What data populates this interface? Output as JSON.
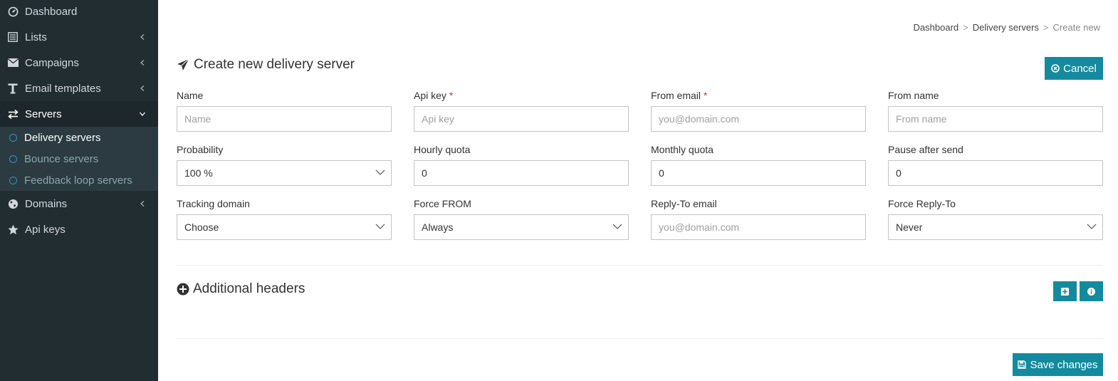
{
  "sidebar": {
    "items": [
      {
        "label": "Dashboard",
        "icon": "dashboard-icon"
      },
      {
        "label": "Lists",
        "icon": "list-icon"
      },
      {
        "label": "Campaigns",
        "icon": "envelope-icon"
      },
      {
        "label": "Email templates",
        "icon": "text-icon"
      },
      {
        "label": "Servers",
        "icon": "exchange-icon"
      },
      {
        "label": "Domains",
        "icon": "globe-icon"
      },
      {
        "label": "Api keys",
        "icon": "star-icon"
      }
    ],
    "submenu": [
      {
        "label": "Delivery servers"
      },
      {
        "label": "Bounce servers"
      },
      {
        "label": "Feedback loop servers"
      }
    ]
  },
  "breadcrumb": {
    "items": [
      "Dashboard",
      "Delivery servers"
    ],
    "separator": ">",
    "current": "Create new"
  },
  "page": {
    "title": "Create new delivery server",
    "cancel_label": "Cancel",
    "save_label": "Save changes"
  },
  "form": {
    "required_mark": "*",
    "name": {
      "label": "Name",
      "placeholder": "Name"
    },
    "api_key": {
      "label": "Api key",
      "placeholder": "Api key"
    },
    "from_email": {
      "label": "From email",
      "placeholder": "you@domain.com"
    },
    "from_name": {
      "label": "From name",
      "placeholder": "From name"
    },
    "probability": {
      "label": "Probability",
      "value": "100 %"
    },
    "hourly_quota": {
      "label": "Hourly quota",
      "value": "0"
    },
    "monthly_quota": {
      "label": "Monthly quota",
      "value": "0"
    },
    "pause_after_send": {
      "label": "Pause after send",
      "value": "0"
    },
    "tracking_domain": {
      "label": "Tracking domain",
      "value": "Choose"
    },
    "force_from": {
      "label": "Force FROM",
      "value": "Always"
    },
    "reply_to_email": {
      "label": "Reply-To email",
      "placeholder": "you@domain.com"
    },
    "force_reply_to": {
      "label": "Force Reply-To",
      "value": "Never"
    }
  },
  "additional_headers": {
    "title": "Additional headers"
  },
  "colors": {
    "sidebar_bg": "#222d32",
    "submenu_bg": "#2c3b41",
    "accent": "#138a9e",
    "required": "#c0392b"
  }
}
